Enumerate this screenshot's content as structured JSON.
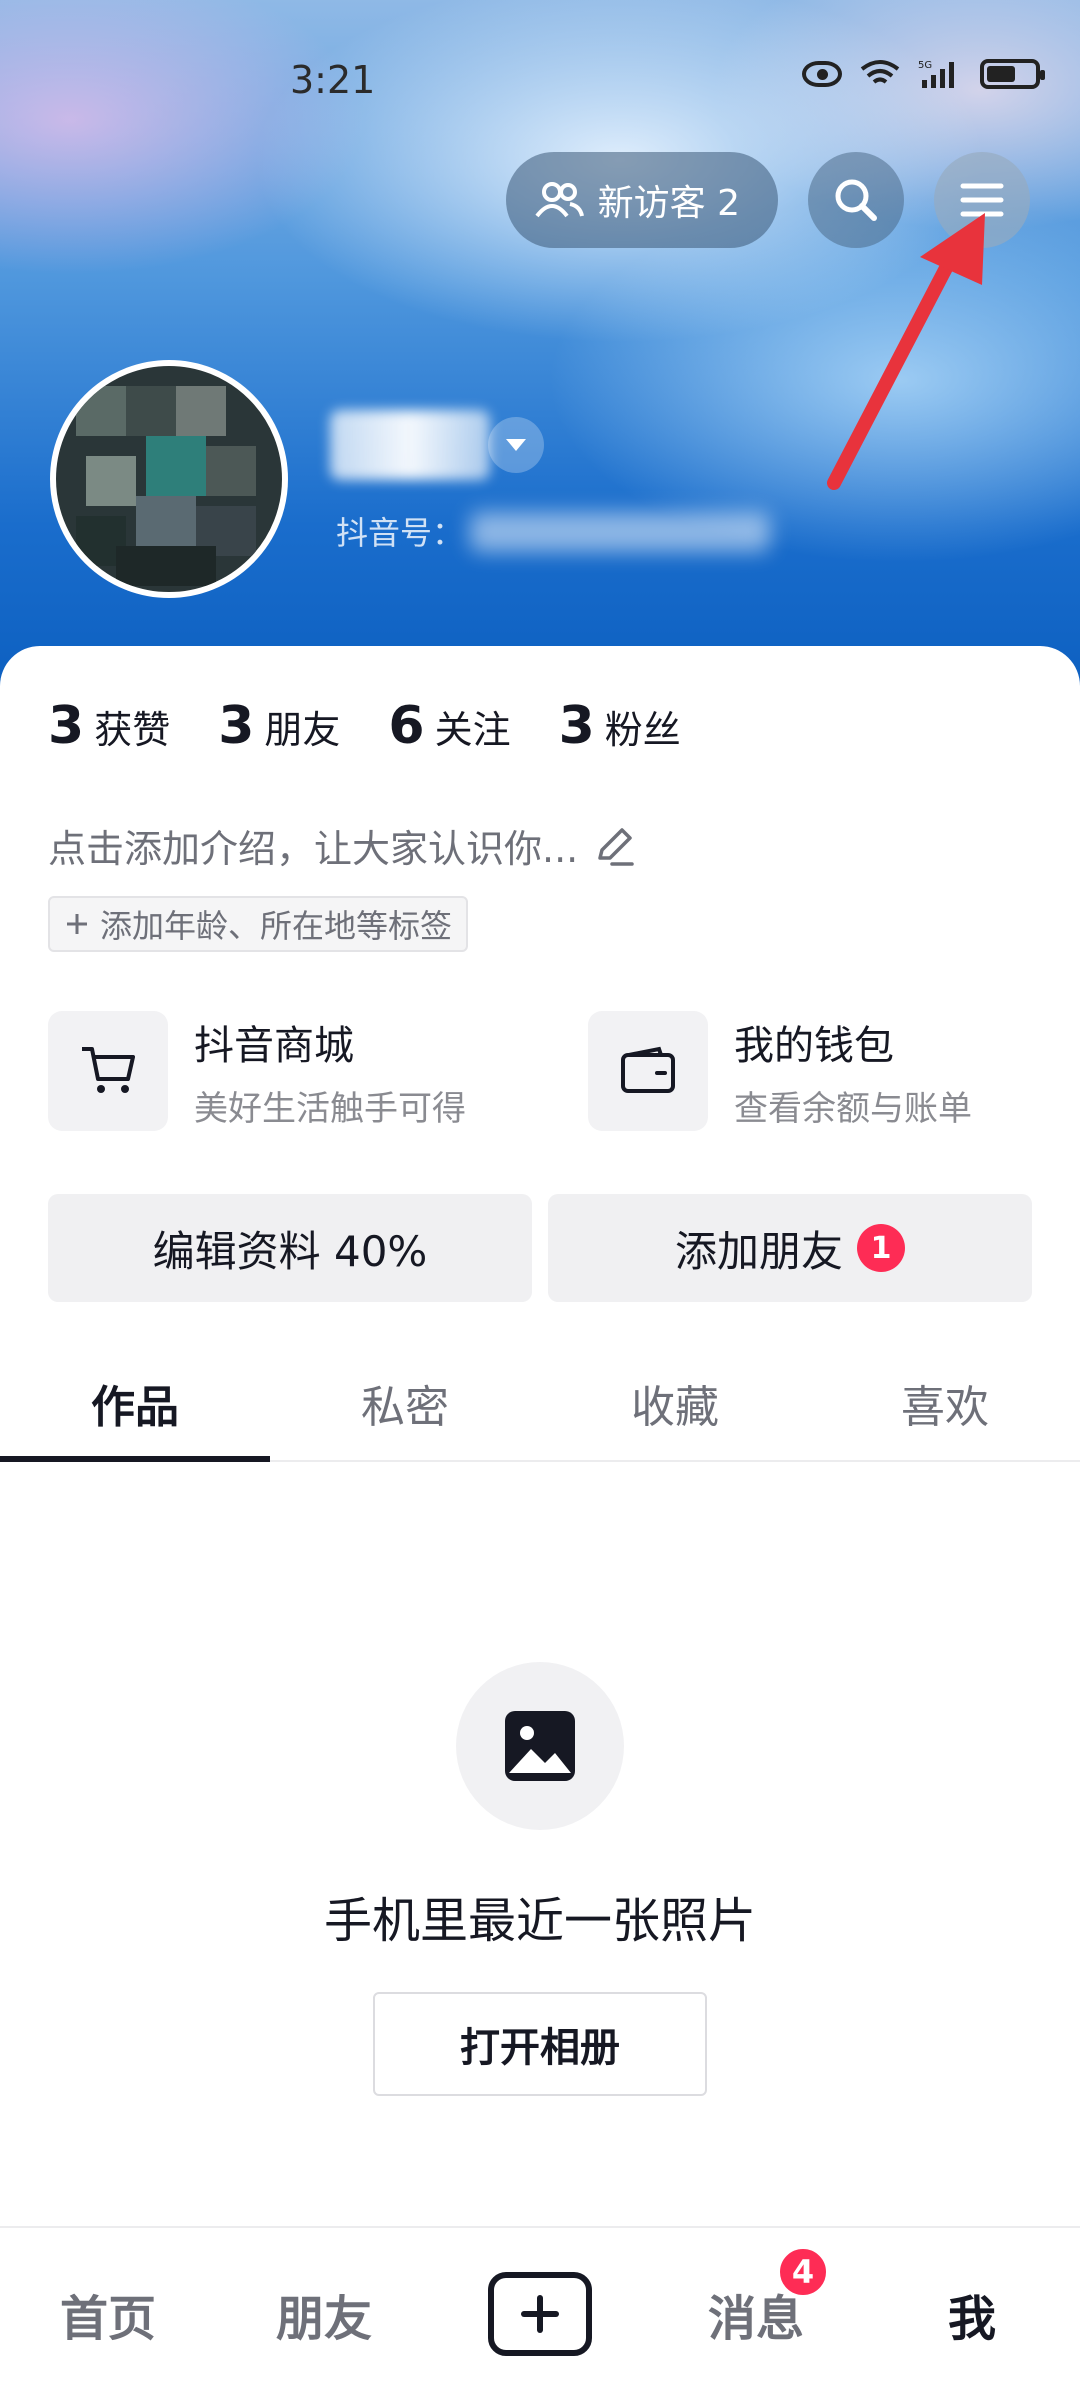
{
  "status_bar": {
    "time": "3:21",
    "network": "5G"
  },
  "header": {
    "visitor_label": "新访客 2",
    "douyin_id_prefix": "抖音号："
  },
  "stats": [
    {
      "num": "3",
      "label": "获赞"
    },
    {
      "num": "3",
      "label": "朋友"
    },
    {
      "num": "6",
      "label": "关注"
    },
    {
      "num": "3",
      "label": "粉丝"
    }
  ],
  "bio": {
    "placeholder": "点击添加介绍，让大家认识你...",
    "tag_button": "添加年龄、所在地等标签"
  },
  "services": [
    {
      "title": "抖音商城",
      "subtitle": "美好生活触手可得",
      "icon": "cart-icon"
    },
    {
      "title": "我的钱包",
      "subtitle": "查看余额与账单",
      "icon": "wallet-icon"
    }
  ],
  "actions": {
    "edit_profile": "编辑资料 40%",
    "add_friend": "添加朋友",
    "add_friend_badge": "1"
  },
  "tabs": [
    "作品",
    "私密",
    "收藏",
    "喜欢"
  ],
  "empty_state": {
    "title": "手机里最近一张照片",
    "button": "打开相册"
  },
  "bottom_nav": {
    "home": "首页",
    "friends": "朋友",
    "messages": "消息",
    "messages_badge": "4",
    "me": "我"
  },
  "colors": {
    "accent": "#fe2c55",
    "text": "#161823",
    "annotation_arrow": "#e8333c"
  }
}
